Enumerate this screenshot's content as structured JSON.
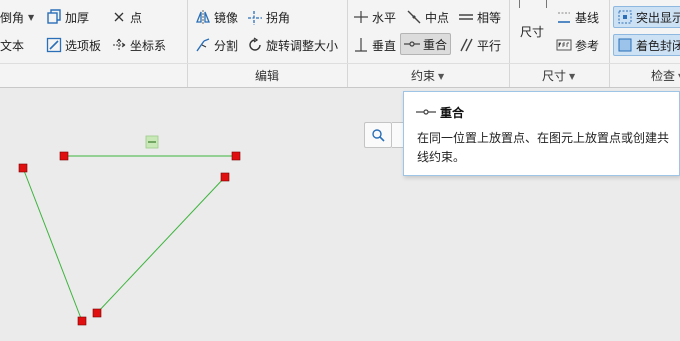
{
  "ribbon": {
    "left_group": {
      "chamfer": "倒角",
      "thicken": "加厚",
      "point": "点",
      "text": "文本",
      "palette": "选项板",
      "coord_system": "坐标系"
    },
    "edit_group": {
      "label": "编辑",
      "mirror": "镜像",
      "corner": "拐角",
      "divide": "分割",
      "rotate_resize": "旋转调整大小"
    },
    "constraint_group": {
      "label": "约束",
      "horizontal": "水平",
      "midpoint": "中点",
      "equal": "相等",
      "vertical": "垂直",
      "coincident": "重合",
      "parallel": "平行"
    },
    "dimension_group": {
      "label": "尺寸",
      "dimension": "尺寸",
      "baseline": "基线",
      "reference": "参考"
    },
    "inspect_group": {
      "label": "检查",
      "highlight_open": "突出显示",
      "shade_closed": "着色封闭"
    }
  },
  "tooltip": {
    "title": "重合",
    "description": "在同一位置上放置点、在图元上放置点或创建共线约束。"
  },
  "colors": {
    "sketch_line": "#3cb43c",
    "vertex": "#e01010",
    "accent": "#2a6fb8"
  }
}
